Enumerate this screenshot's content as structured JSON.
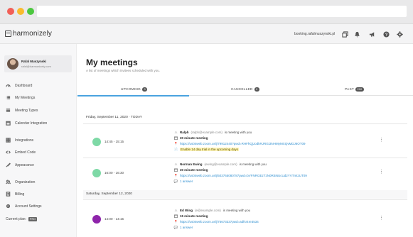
{
  "browser": {},
  "app": {
    "logo_text": "harmonizely",
    "booking_url": "booking.rafalmuszynski.pl",
    "top_icons": [
      "copy-icon",
      "bell-icon",
      "megaphone-icon",
      "help-icon",
      "settings-icon"
    ]
  },
  "user": {
    "name": "Rafal Muszynski",
    "email": "rafal@harmonizely.com"
  },
  "sidebar": {
    "items": [
      {
        "label": "Dashboard",
        "icon": "dashboard-icon"
      },
      {
        "label": "My Meetings",
        "icon": "list-icon"
      },
      {
        "label": "Meeting Types",
        "icon": "menu-icon"
      },
      {
        "label": "Calendar Integration",
        "icon": "calendar-icon"
      },
      {
        "label": "Integrations",
        "icon": "integrations-icon"
      },
      {
        "label": "Embed Code",
        "icon": "code-icon"
      },
      {
        "label": "Appearance",
        "icon": "paint-icon"
      },
      {
        "label": "Organization",
        "icon": "organization-icon"
      },
      {
        "label": "Billing",
        "icon": "billing-icon"
      },
      {
        "label": "Account Settings",
        "icon": "account-settings-icon"
      }
    ],
    "plan_label": "Current plan:",
    "plan_badge": "PRO"
  },
  "main": {
    "title": "My meetings",
    "subtitle": "A list of meetings which invitees scheduled with you.",
    "tabs": [
      {
        "label": "UPCOMING",
        "count": "3"
      },
      {
        "label": "CANCELLED",
        "count": "0"
      },
      {
        "label": "PAST",
        "count": "200"
      }
    ],
    "days": [
      {
        "date": "Friday, September 11, 2020 · TODAY",
        "meetings": [
          {
            "time": "14:45 - 15:15",
            "name": "Ralph",
            "email": "(ralph@example.com)",
            "suffix": "is meeting with you",
            "type": "30 minute meeting",
            "url": "https://us04web.zoom.us/j/79912440?pwd=RHFhQjJodkRJRGt3NHMyMXQvMDJ6OT09",
            "note": "Enable 14 day trial in the upcoming days",
            "dot_color": "#7ed9a6"
          },
          {
            "time": "16:00 - 16:30",
            "name": "Norman Ewing",
            "email": "(ewing@example.com)",
            "suffix": "is meeting with you",
            "type": "30 minute meeting",
            "url": "https://us04web.zoom.us/j/503765080787pwd=bVFNRGEzTzN0RBNUcUd2YVTmtzUT09",
            "answers": "1 answer",
            "dot_color": "#7ed9a6"
          }
        ]
      },
      {
        "date": "Saturday, September 12, 2020",
        "meetings": [
          {
            "time": "14:00 - 14:15",
            "name": "Ed Wing",
            "email": "(e@example.com)",
            "suffix": "is meeting with you",
            "type": "15 minute meeting",
            "url": "https://us04web.zoom.us/j/75673337pwd=adfsr4re3534",
            "answers": "1 answer",
            "dot_color": "#8e24aa"
          }
        ]
      }
    ]
  }
}
